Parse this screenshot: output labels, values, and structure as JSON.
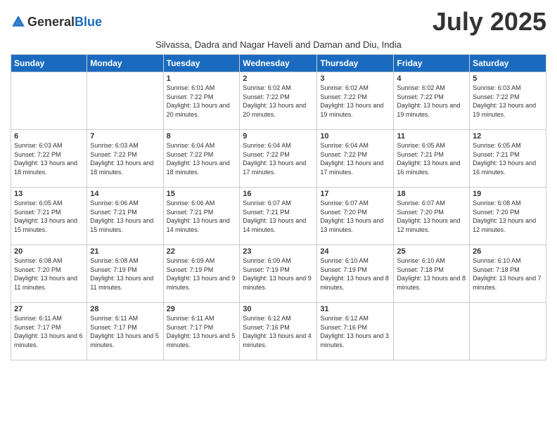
{
  "logo": {
    "general": "General",
    "blue": "Blue"
  },
  "title": "July 2025",
  "subtitle": "Silvassa, Dadra and Nagar Haveli and Daman and Diu, India",
  "weekdays": [
    "Sunday",
    "Monday",
    "Tuesday",
    "Wednesday",
    "Thursday",
    "Friday",
    "Saturday"
  ],
  "weeks": [
    [
      {
        "day": "",
        "sunrise": "",
        "sunset": "",
        "daylight": ""
      },
      {
        "day": "",
        "sunrise": "",
        "sunset": "",
        "daylight": ""
      },
      {
        "day": "1",
        "sunrise": "Sunrise: 6:01 AM",
        "sunset": "Sunset: 7:22 PM",
        "daylight": "Daylight: 13 hours and 20 minutes."
      },
      {
        "day": "2",
        "sunrise": "Sunrise: 6:02 AM",
        "sunset": "Sunset: 7:22 PM",
        "daylight": "Daylight: 13 hours and 20 minutes."
      },
      {
        "day": "3",
        "sunrise": "Sunrise: 6:02 AM",
        "sunset": "Sunset: 7:22 PM",
        "daylight": "Daylight: 13 hours and 19 minutes."
      },
      {
        "day": "4",
        "sunrise": "Sunrise: 6:02 AM",
        "sunset": "Sunset: 7:22 PM",
        "daylight": "Daylight: 13 hours and 19 minutes."
      },
      {
        "day": "5",
        "sunrise": "Sunrise: 6:03 AM",
        "sunset": "Sunset: 7:22 PM",
        "daylight": "Daylight: 13 hours and 19 minutes."
      }
    ],
    [
      {
        "day": "6",
        "sunrise": "Sunrise: 6:03 AM",
        "sunset": "Sunset: 7:22 PM",
        "daylight": "Daylight: 13 hours and 18 minutes."
      },
      {
        "day": "7",
        "sunrise": "Sunrise: 6:03 AM",
        "sunset": "Sunset: 7:22 PM",
        "daylight": "Daylight: 13 hours and 18 minutes."
      },
      {
        "day": "8",
        "sunrise": "Sunrise: 6:04 AM",
        "sunset": "Sunset: 7:22 PM",
        "daylight": "Daylight: 13 hours and 18 minutes."
      },
      {
        "day": "9",
        "sunrise": "Sunrise: 6:04 AM",
        "sunset": "Sunset: 7:22 PM",
        "daylight": "Daylight: 13 hours and 17 minutes."
      },
      {
        "day": "10",
        "sunrise": "Sunrise: 6:04 AM",
        "sunset": "Sunset: 7:22 PM",
        "daylight": "Daylight: 13 hours and 17 minutes."
      },
      {
        "day": "11",
        "sunrise": "Sunrise: 6:05 AM",
        "sunset": "Sunset: 7:21 PM",
        "daylight": "Daylight: 13 hours and 16 minutes."
      },
      {
        "day": "12",
        "sunrise": "Sunrise: 6:05 AM",
        "sunset": "Sunset: 7:21 PM",
        "daylight": "Daylight: 13 hours and 16 minutes."
      }
    ],
    [
      {
        "day": "13",
        "sunrise": "Sunrise: 6:05 AM",
        "sunset": "Sunset: 7:21 PM",
        "daylight": "Daylight: 13 hours and 15 minutes."
      },
      {
        "day": "14",
        "sunrise": "Sunrise: 6:06 AM",
        "sunset": "Sunset: 7:21 PM",
        "daylight": "Daylight: 13 hours and 15 minutes."
      },
      {
        "day": "15",
        "sunrise": "Sunrise: 6:06 AM",
        "sunset": "Sunset: 7:21 PM",
        "daylight": "Daylight: 13 hours and 14 minutes."
      },
      {
        "day": "16",
        "sunrise": "Sunrise: 6:07 AM",
        "sunset": "Sunset: 7:21 PM",
        "daylight": "Daylight: 13 hours and 14 minutes."
      },
      {
        "day": "17",
        "sunrise": "Sunrise: 6:07 AM",
        "sunset": "Sunset: 7:20 PM",
        "daylight": "Daylight: 13 hours and 13 minutes."
      },
      {
        "day": "18",
        "sunrise": "Sunrise: 6:07 AM",
        "sunset": "Sunset: 7:20 PM",
        "daylight": "Daylight: 13 hours and 12 minutes."
      },
      {
        "day": "19",
        "sunrise": "Sunrise: 6:08 AM",
        "sunset": "Sunset: 7:20 PM",
        "daylight": "Daylight: 13 hours and 12 minutes."
      }
    ],
    [
      {
        "day": "20",
        "sunrise": "Sunrise: 6:08 AM",
        "sunset": "Sunset: 7:20 PM",
        "daylight": "Daylight: 13 hours and 11 minutes."
      },
      {
        "day": "21",
        "sunrise": "Sunrise: 6:08 AM",
        "sunset": "Sunset: 7:19 PM",
        "daylight": "Daylight: 13 hours and 11 minutes."
      },
      {
        "day": "22",
        "sunrise": "Sunrise: 6:09 AM",
        "sunset": "Sunset: 7:19 PM",
        "daylight": "Daylight: 13 hours and 9 minutes."
      },
      {
        "day": "23",
        "sunrise": "Sunrise: 6:09 AM",
        "sunset": "Sunset: 7:19 PM",
        "daylight": "Daylight: 13 hours and 9 minutes."
      },
      {
        "day": "24",
        "sunrise": "Sunrise: 6:10 AM",
        "sunset": "Sunset: 7:19 PM",
        "daylight": "Daylight: 13 hours and 8 minutes."
      },
      {
        "day": "25",
        "sunrise": "Sunrise: 6:10 AM",
        "sunset": "Sunset: 7:18 PM",
        "daylight": "Daylight: 13 hours and 8 minutes."
      },
      {
        "day": "26",
        "sunrise": "Sunrise: 6:10 AM",
        "sunset": "Sunset: 7:18 PM",
        "daylight": "Daylight: 13 hours and 7 minutes."
      }
    ],
    [
      {
        "day": "27",
        "sunrise": "Sunrise: 6:11 AM",
        "sunset": "Sunset: 7:17 PM",
        "daylight": "Daylight: 13 hours and 6 minutes."
      },
      {
        "day": "28",
        "sunrise": "Sunrise: 6:11 AM",
        "sunset": "Sunset: 7:17 PM",
        "daylight": "Daylight: 13 hours and 5 minutes."
      },
      {
        "day": "29",
        "sunrise": "Sunrise: 6:11 AM",
        "sunset": "Sunset: 7:17 PM",
        "daylight": "Daylight: 13 hours and 5 minutes."
      },
      {
        "day": "30",
        "sunrise": "Sunrise: 6:12 AM",
        "sunset": "Sunset: 7:16 PM",
        "daylight": "Daylight: 13 hours and 4 minutes."
      },
      {
        "day": "31",
        "sunrise": "Sunrise: 6:12 AM",
        "sunset": "Sunset: 7:16 PM",
        "daylight": "Daylight: 13 hours and 3 minutes."
      },
      {
        "day": "",
        "sunrise": "",
        "sunset": "",
        "daylight": ""
      },
      {
        "day": "",
        "sunrise": "",
        "sunset": "",
        "daylight": ""
      }
    ]
  ]
}
